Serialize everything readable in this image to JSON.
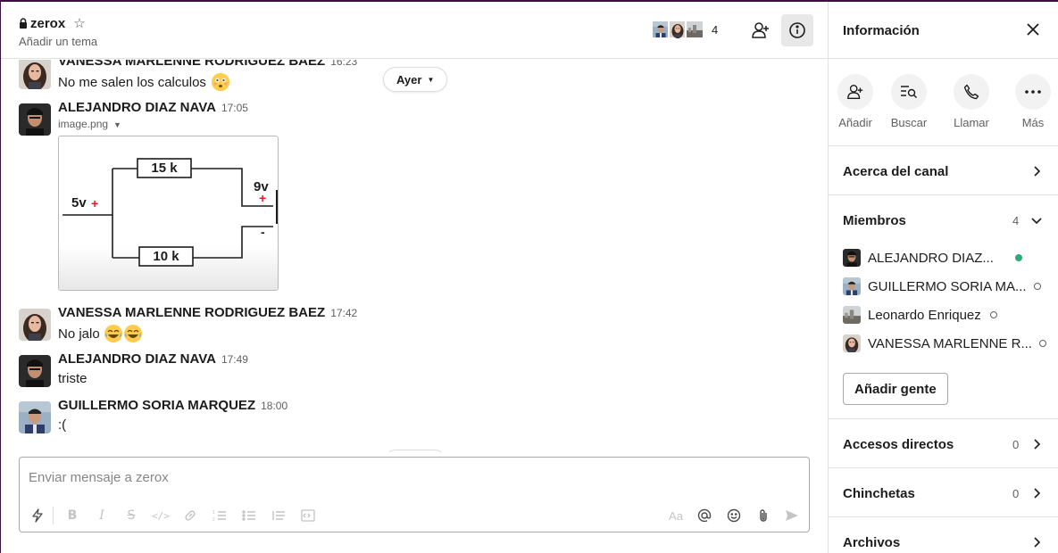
{
  "header": {
    "channel": "zerox",
    "topic": "Añadir un tema",
    "member_count": "4"
  },
  "messages": [
    {
      "author": "VANESSA MARLENNE RODRIGUEZ BAEZ",
      "time": "16:23",
      "text": "No me salen los calculos"
    },
    {
      "author": "ALEJANDRO DIAZ NAVA",
      "time": "17:05",
      "file": "image.png"
    },
    {
      "author": "VANESSA MARLENNE RODRIGUEZ BAEZ",
      "time": "17:42",
      "text": "No jalo"
    },
    {
      "author": "ALEJANDRO DIAZ NAVA",
      "time": "17:49",
      "text": "triste"
    },
    {
      "author": "GUILLERMO SORIA MARQUEZ",
      "time": "18:00",
      "text": ":("
    }
  ],
  "day_divider": "Ayer",
  "circuit": {
    "r1": "15 k",
    "r2": "10 k",
    "source_left": "5v",
    "source_right": "9v",
    "plus": "+",
    "minus": "-"
  },
  "composer": {
    "placeholder": "Enviar mensaje a zerox",
    "format_label": "Aa"
  },
  "sidebar": {
    "title": "Información",
    "actions": [
      {
        "label": "Añadir",
        "icon": "add-person-icon"
      },
      {
        "label": "Buscar",
        "icon": "search-list-icon"
      },
      {
        "label": "Llamar",
        "icon": "phone-icon"
      },
      {
        "label": "Más",
        "icon": "more-icon"
      }
    ],
    "about": "Acerca del canal",
    "members_label": "Miembros",
    "members_count": "4",
    "members": [
      {
        "name": "ALEJANDRO DIAZ...",
        "status": "active"
      },
      {
        "name": "GUILLERMO SORIA MA...",
        "status": "away"
      },
      {
        "name": "Leonardo Enriquez",
        "status": "away"
      },
      {
        "name": "VANESSA MARLENNE R...",
        "status": "away"
      }
    ],
    "add_people": "Añadir gente",
    "shortcuts_label": "Accesos directos",
    "shortcuts_count": "0",
    "pins_label": "Chinchetas",
    "pins_count": "0",
    "files_label": "Archivos"
  },
  "colors": {
    "active": "#2bac76",
    "away_border": "#616061",
    "plus_red": "#e01e2b"
  }
}
